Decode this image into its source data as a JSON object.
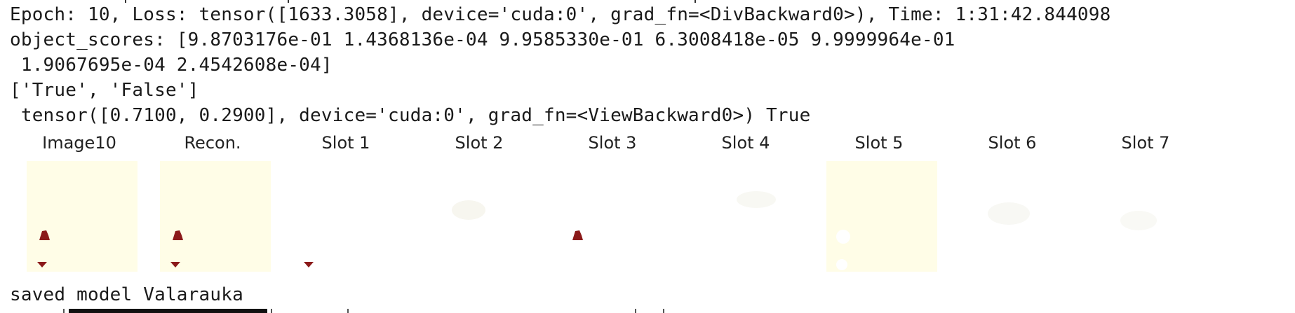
{
  "log": {
    "epoch_line": "Epoch: 10, Loss: tensor([1633.3058], device='cuda:0', grad_fn=<DivBackward0>), Time: 1:31:42.844098",
    "scores_line_1": "object_scores: [9.8703176e-01 1.4368136e-04 9.9585330e-01 6.3008418e-05 9.9999964e-01",
    "scores_line_2": " 1.9067695e-04 2.4542608e-04]",
    "labels_line": "['True', 'False']",
    "tensor_line": " tensor([0.7100, 0.2900], device='cuda:0', grad_fn=<ViewBackward0>) True",
    "saved_line": "saved model Valarauka"
  },
  "figure": {
    "panels": [
      {
        "title": "Image10",
        "background": "#fffde7",
        "content": "scene"
      },
      {
        "title": "Recon.",
        "background": "#fffde7",
        "content": "scene"
      },
      {
        "title": "Slot 1",
        "background": "#ffffff",
        "content": "bottom-object"
      },
      {
        "title": "Slot 2",
        "background": "#ffffff",
        "content": "faint"
      },
      {
        "title": "Slot 3",
        "background": "#ffffff",
        "content": "top-object"
      },
      {
        "title": "Slot 4",
        "background": "#ffffff",
        "content": "faint"
      },
      {
        "title": "Slot 5",
        "background": "#fffde7",
        "content": "holes"
      },
      {
        "title": "Slot 6",
        "background": "#ffffff",
        "content": "faint"
      },
      {
        "title": "Slot 7",
        "background": "#ffffff",
        "content": "faint"
      }
    ],
    "colors": {
      "object": "#8b1a1a",
      "background": "#fffde7"
    }
  }
}
